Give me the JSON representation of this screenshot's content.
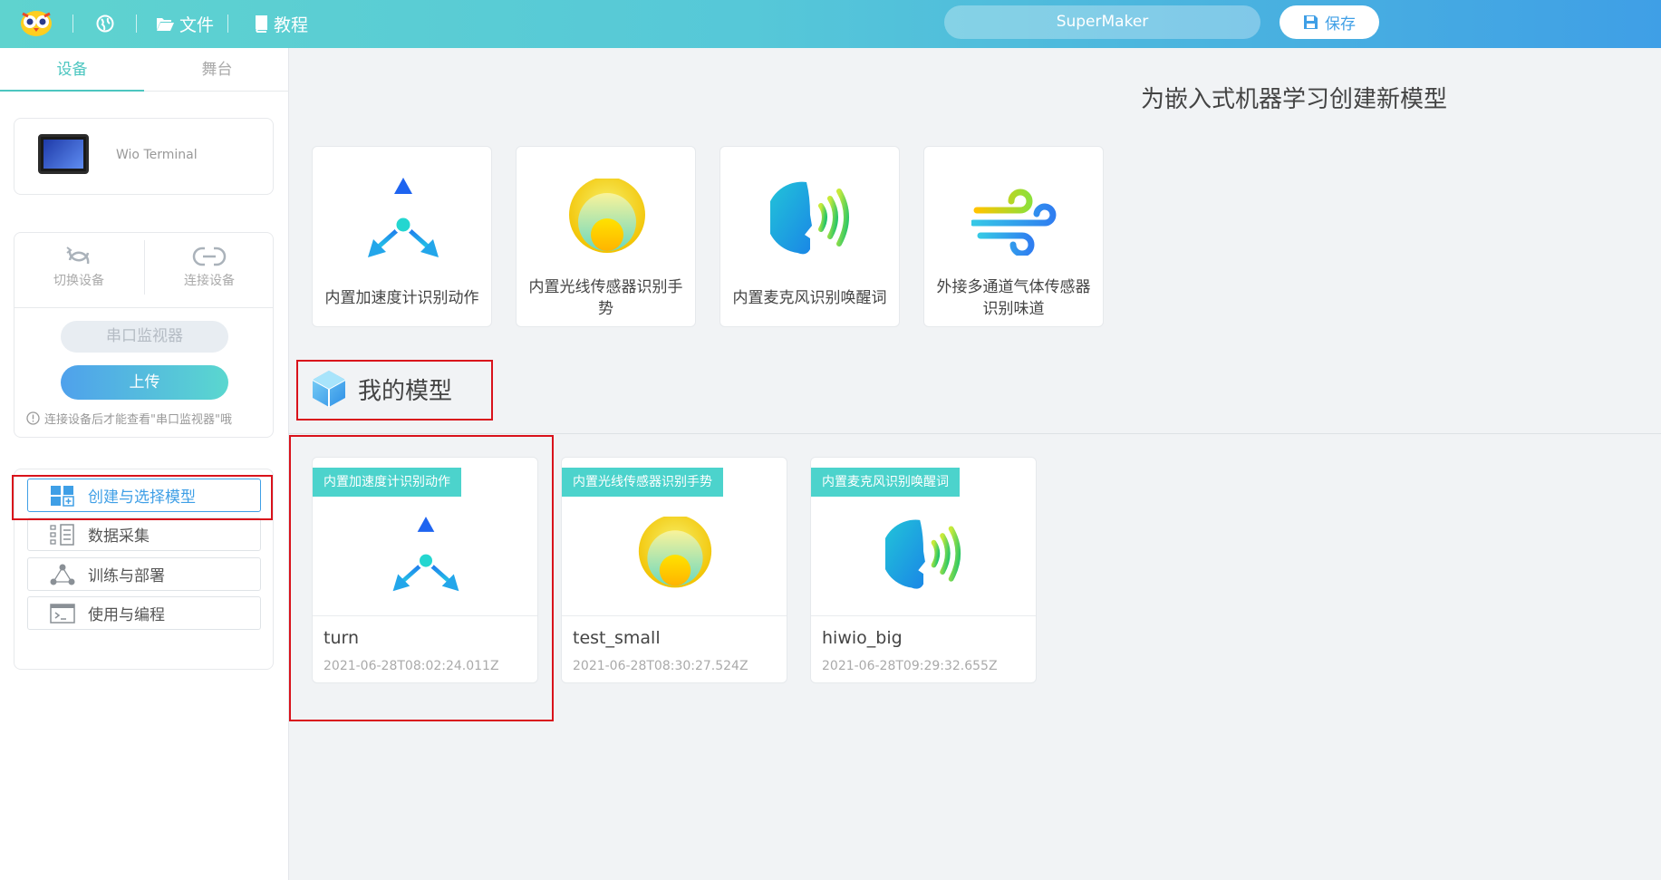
{
  "topbar": {
    "menu_file": "文件",
    "menu_tutorial": "教程",
    "project_name": "SuperMaker",
    "save_label": "保存"
  },
  "sidebar": {
    "tabs": [
      {
        "label": "设备",
        "active": true
      },
      {
        "label": "舞台",
        "active": false
      }
    ],
    "device": {
      "name": "Wio Terminal"
    },
    "controls": {
      "switch_label": "切换设备",
      "connect_label": "连接设备",
      "serial_label": "串口监视器",
      "upload_label": "上传",
      "hint": "连接设备后才能查看\"串口监视器\"哦"
    },
    "steps": [
      {
        "label": "创建与选择模型",
        "icon": "grid-add-icon",
        "active": true
      },
      {
        "label": "数据采集",
        "icon": "data-collect-icon",
        "active": false
      },
      {
        "label": "训练与部署",
        "icon": "network-icon",
        "active": false
      },
      {
        "label": "使用与编程",
        "icon": "terminal-icon",
        "active": false
      }
    ]
  },
  "main": {
    "heading": "为嵌入式机器学习创建新模型",
    "templates": [
      {
        "label": "内置加速度计识别动作",
        "icon": "accelerometer-icon"
      },
      {
        "label": "内置光线传感器识别手势",
        "icon": "light-sensor-icon"
      },
      {
        "label": "内置麦克风识别唤醒词",
        "icon": "microphone-voice-icon"
      },
      {
        "label": "外接多通道气体传感器识别味道",
        "icon": "gas-wind-icon"
      }
    ],
    "my_models_title": "我的模型",
    "models": [
      {
        "tag": "内置加速度计识别动作",
        "name": "turn",
        "timestamp": "2021-06-28T08:02:24.011Z",
        "icon": "accelerometer-icon"
      },
      {
        "tag": "内置光线传感器识别手势",
        "name": "test_small",
        "timestamp": "2021-06-28T08:30:27.524Z",
        "icon": "light-sensor-icon"
      },
      {
        "tag": "内置麦克风识别唤醒词",
        "name": "hiwio_big",
        "timestamp": "2021-06-28T09:29:32.655Z",
        "icon": "microphone-voice-icon"
      }
    ]
  },
  "colors": {
    "accent": "#4cc6c0",
    "primary": "#3f9fe6",
    "highlight_box": "#d9121b"
  }
}
